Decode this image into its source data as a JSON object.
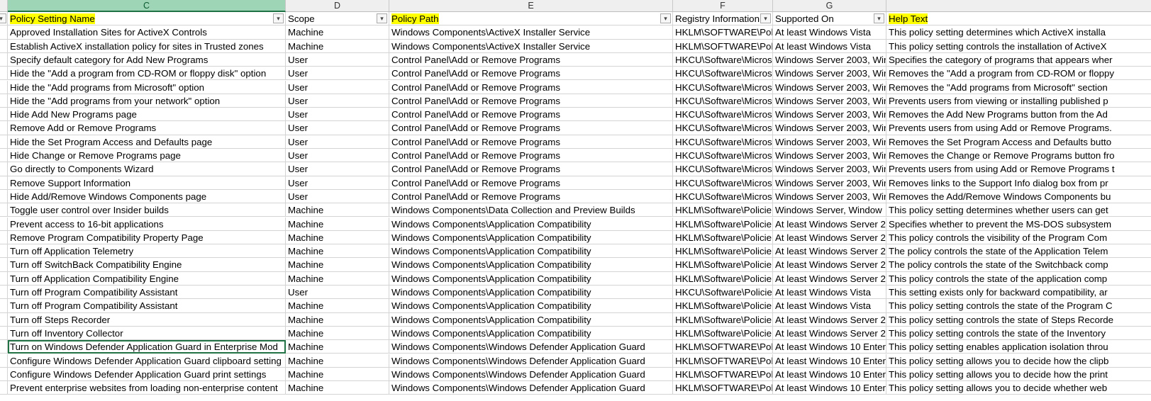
{
  "column_letters": [
    "C",
    "D",
    "E",
    "F",
    "G"
  ],
  "headers": [
    "Policy Setting Name",
    "Scope",
    "Policy Path",
    "Registry Information",
    "Supported On",
    "Help Text"
  ],
  "header_highlight_color": "#ffff00",
  "selection_color": "#217346",
  "filter_icon": "chevron-down-icon",
  "rows": [
    [
      "Approved Installation Sites for ActiveX Controls",
      "Machine",
      "Windows Components\\ActiveX Installer Service",
      "HKLM\\SOFTWARE\\Polic",
      "At least Windows Vista",
      "This policy setting determines which ActiveX installa"
    ],
    [
      "Establish ActiveX installation policy for sites in Trusted zones",
      "Machine",
      "Windows Components\\ActiveX Installer Service",
      "HKLM\\SOFTWARE\\Polic",
      "At least Windows Vista",
      "This policy setting controls the installation of ActiveX"
    ],
    [
      "Specify default category for Add New Programs",
      "User",
      "Control Panel\\Add or Remove Programs",
      "HKCU\\Software\\Micros",
      "Windows Server 2003, Wir",
      "Specifies the category of programs that appears wher"
    ],
    [
      "Hide the \"Add a program from CD-ROM or floppy disk\" option",
      "User",
      "Control Panel\\Add or Remove Programs",
      "HKCU\\Software\\Micros",
      "Windows Server 2003, Wir",
      "Removes the \"Add a program from CD-ROM or floppy"
    ],
    [
      "Hide the \"Add programs from Microsoft\" option",
      "User",
      "Control Panel\\Add or Remove Programs",
      "HKCU\\Software\\Micros",
      "Windows Server 2003, Wir",
      "Removes the \"Add programs from Microsoft\" section"
    ],
    [
      "Hide the \"Add programs from your network\" option",
      "User",
      "Control Panel\\Add or Remove Programs",
      "HKCU\\Software\\Micros",
      "Windows Server 2003, Wir",
      "Prevents users from viewing or installing published p"
    ],
    [
      "Hide Add New Programs page",
      "User",
      "Control Panel\\Add or Remove Programs",
      "HKCU\\Software\\Micros",
      "Windows Server 2003, Wir",
      "Removes the Add New Programs button from the Ad"
    ],
    [
      "Remove Add or Remove Programs",
      "User",
      "Control Panel\\Add or Remove Programs",
      "HKCU\\Software\\Micros",
      "Windows Server 2003, Wir",
      "Prevents users from using Add or Remove Programs."
    ],
    [
      "Hide the Set Program Access and Defaults page",
      "User",
      "Control Panel\\Add or Remove Programs",
      "HKCU\\Software\\Micros",
      "Windows Server 2003, Wir",
      "Removes the Set Program Access and Defaults butto"
    ],
    [
      "Hide Change or Remove Programs page",
      "User",
      "Control Panel\\Add or Remove Programs",
      "HKCU\\Software\\Micros",
      "Windows Server 2003, Wir",
      "Removes the Change or Remove Programs button fro"
    ],
    [
      "Go directly to Components Wizard",
      "User",
      "Control Panel\\Add or Remove Programs",
      "HKCU\\Software\\Micros",
      "Windows Server 2003, Wir",
      "Prevents users from using Add or Remove Programs t"
    ],
    [
      "Remove Support Information",
      "User",
      "Control Panel\\Add or Remove Programs",
      "HKCU\\Software\\Micros",
      "Windows Server 2003, Wir",
      "Removes links to the Support Info dialog box from pr"
    ],
    [
      "Hide Add/Remove Windows Components page",
      "User",
      "Control Panel\\Add or Remove Programs",
      "HKCU\\Software\\Micros",
      "Windows Server 2003, Wir",
      "Removes the Add/Remove Windows Components bu"
    ],
    [
      "Toggle user control over Insider builds",
      "Machine",
      "Windows Components\\Data Collection and Preview Builds",
      "HKLM\\Software\\Policie",
      "Windows Server, Window",
      "This policy setting determines whether users can get"
    ],
    [
      "Prevent access to 16-bit applications",
      "Machine",
      "Windows Components\\Application Compatibility",
      "HKLM\\Software\\Policie",
      "At least Windows Server 2",
      "Specifies whether to prevent the MS-DOS subsystem"
    ],
    [
      "Remove Program Compatibility Property Page",
      "Machine",
      "Windows Components\\Application Compatibility",
      "HKLM\\Software\\Policie",
      "At least Windows Server 2",
      "This policy controls the visibility of the Program Com"
    ],
    [
      "Turn off Application Telemetry",
      "Machine",
      "Windows Components\\Application Compatibility",
      "HKLM\\Software\\Policie",
      "At least Windows Server 2",
      "The policy controls the state of the Application Telem"
    ],
    [
      "Turn off SwitchBack Compatibility Engine",
      "Machine",
      "Windows Components\\Application Compatibility",
      "HKLM\\Software\\Policie",
      "At least Windows Server 2",
      "The policy controls the state of the Switchback comp"
    ],
    [
      "Turn off Application Compatibility Engine",
      "Machine",
      "Windows Components\\Application Compatibility",
      "HKLM\\Software\\Policie",
      "At least Windows Server 2",
      "This policy controls the state of the application comp"
    ],
    [
      "Turn off Program Compatibility Assistant",
      "User",
      "Windows Components\\Application Compatibility",
      "HKCU\\Software\\Policie",
      "At least Windows Vista",
      "This setting exists only for backward compatibility, ar"
    ],
    [
      "Turn off Program Compatibility Assistant",
      "Machine",
      "Windows Components\\Application Compatibility",
      "HKLM\\Software\\Policie",
      "At least Windows Vista",
      "This policy setting controls the state of the Program C"
    ],
    [
      "Turn off Steps Recorder",
      "Machine",
      "Windows Components\\Application Compatibility",
      "HKLM\\Software\\Policie",
      "At least Windows Server 2",
      "This policy setting controls the state of Steps Recorde"
    ],
    [
      "Turn off Inventory Collector",
      "Machine",
      "Windows Components\\Application Compatibility",
      "HKLM\\Software\\Policie",
      "At least Windows Server 2",
      "This policy setting controls the state of the Inventory"
    ],
    [
      "Turn on Windows Defender Application Guard in Enterprise Mod",
      "Machine",
      "Windows Components\\Windows Defender Application Guard",
      "HKLM\\SOFTWARE\\Polic",
      "At least Windows 10 Enter",
      "This policy setting enables application isolation throu"
    ],
    [
      "Configure Windows Defender Application Guard clipboard setting",
      "Machine",
      "Windows Components\\Windows Defender Application Guard",
      "HKLM\\SOFTWARE\\Polic",
      "At least Windows 10 Enter",
      "This policy setting allows you to decide how the clipb"
    ],
    [
      "Configure Windows Defender Application Guard print settings",
      "Machine",
      "Windows Components\\Windows Defender Application Guard",
      "HKLM\\SOFTWARE\\Polic",
      "At least Windows 10 Enter",
      "This policy setting allows you to decide how the print"
    ],
    [
      "Prevent enterprise websites from loading non-enterprise content",
      "Machine",
      "Windows Components\\Windows Defender Application Guard",
      "HKLM\\SOFTWARE\\Polic",
      "At least Windows 10 Enter",
      "This policy setting allows you to decide whether web"
    ]
  ]
}
